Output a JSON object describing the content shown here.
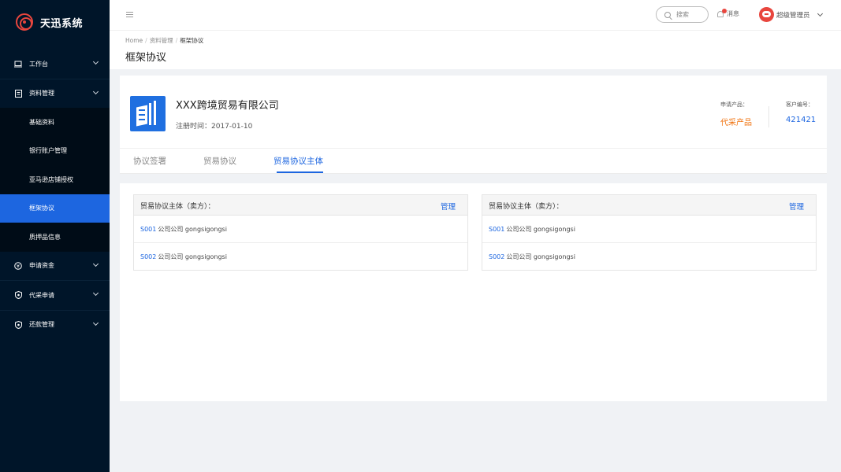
{
  "app": {
    "name": "天迅系统"
  },
  "sidebar": {
    "items": [
      {
        "label": "工作台",
        "icon": "monitor-icon"
      },
      {
        "label": "资料管理",
        "icon": "document-icon"
      },
      {
        "label": "基础资料"
      },
      {
        "label": "银行账户管理"
      },
      {
        "label": "亚马逊店铺授权"
      },
      {
        "label": "框架协议",
        "active": true
      },
      {
        "label": "质押品信息"
      },
      {
        "label": "申请资金",
        "icon": "yen-icon"
      },
      {
        "label": "代采申请",
        "icon": "shield-icon"
      },
      {
        "label": "还款管理",
        "icon": "shield-icon"
      }
    ]
  },
  "header": {
    "search_placeholder": "搜索",
    "messages_label": "消息",
    "user_name": "超级管理员"
  },
  "breadcrumb": {
    "home": "Home",
    "level1": "资料管理",
    "current": "框架协议"
  },
  "page": {
    "title": "框架协议"
  },
  "company": {
    "name": "XXX跨境贸易有限公司",
    "registered": "注册时间：2017-01-10",
    "product_label": "申请产品：",
    "product_value": "代采产品",
    "customer_no_label": "客户编号：",
    "customer_no_value": "421421"
  },
  "tabs": [
    {
      "label": "协议签署"
    },
    {
      "label": "贸易协议"
    },
    {
      "label": "贸易协议主体",
      "active": true
    }
  ],
  "panels": [
    {
      "title": "贸易协议主体（卖方）：",
      "manage_label": "管理",
      "rows": [
        {
          "code": "S001",
          "text": "公司公司 gongsigongsi"
        },
        {
          "code": "S002",
          "text": "公司公司 gongsigongsi"
        }
      ]
    },
    {
      "title": "贸易协议主体（卖方）：",
      "manage_label": "管理",
      "rows": [
        {
          "code": "S001",
          "text": "公司公司 gongsigongsi"
        },
        {
          "code": "S002",
          "text": "公司公司 gongsigongsi"
        }
      ]
    }
  ],
  "colors": {
    "primary": "#1d66e0",
    "sidebar_bg": "#001529",
    "accent_orange": "#f0720e",
    "brand_red": "#e8463e"
  }
}
